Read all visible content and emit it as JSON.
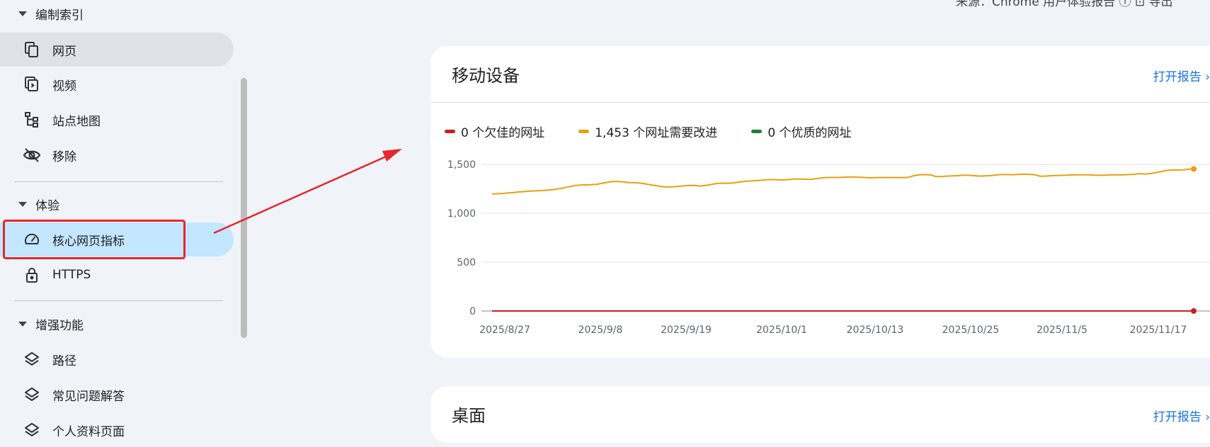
{
  "top_clip_text": "来源：Chrome 用户体验报告 ⓘ   ⊡ 导出",
  "sidebar": {
    "sections": [
      {
        "label": "编制索引"
      },
      {
        "label": "体验"
      },
      {
        "label": "增强功能"
      }
    ],
    "items": [
      {
        "label": "网页",
        "icon": "pages-icon"
      },
      {
        "label": "视频",
        "icon": "video-icon"
      },
      {
        "label": "站点地图",
        "icon": "sitemap-icon"
      },
      {
        "label": "移除",
        "icon": "eye-off-icon"
      },
      {
        "label": "核心网页指标",
        "icon": "speedometer-icon"
      },
      {
        "label": "HTTPS",
        "icon": "lock-icon"
      },
      {
        "label": "路径",
        "icon": "layers-icon"
      },
      {
        "label": "常见问题解答",
        "icon": "layers-icon"
      },
      {
        "label": "个人资料页面",
        "icon": "layers-icon"
      }
    ]
  },
  "mobile_card": {
    "title": "移动设备",
    "open_report": "打开报告 ›"
  },
  "desktop_card": {
    "title": "桌面",
    "open_report": "打开报告 ›"
  },
  "chart_data": {
    "type": "line",
    "title": "",
    "xlabel": "",
    "ylabel": "",
    "ylim": [
      0,
      1600
    ],
    "yticks": [
      "0",
      "500",
      "1,000",
      "1,500"
    ],
    "xticks": [
      "2025/8/27",
      "2025/9/8",
      "2025/9/19",
      "2025/10/1",
      "2025/10/13",
      "2025/10/25",
      "2025/11/5",
      "2025/11/17"
    ],
    "legend_position": "top-left",
    "series": [
      {
        "name": "0 个欠佳的网址",
        "color": "#c5221f",
        "values": [
          0,
          0,
          0,
          0,
          0,
          0,
          0,
          0,
          0,
          0,
          0,
          0,
          0,
          0,
          0,
          0,
          0,
          0,
          0,
          0,
          0,
          0,
          0,
          0,
          0,
          0,
          0,
          0,
          0,
          0,
          0,
          0,
          0,
          0,
          0,
          0,
          0,
          0,
          0,
          0,
          0,
          0,
          0,
          0,
          0,
          0,
          0,
          0,
          0,
          0,
          0,
          0,
          0,
          0,
          0,
          0,
          0,
          0,
          0,
          0,
          0,
          0,
          0,
          0,
          0,
          0,
          0,
          0,
          0,
          0,
          0,
          0,
          0,
          0,
          0,
          0,
          0,
          0,
          0,
          0,
          0,
          0,
          0,
          0,
          0,
          0,
          0,
          0,
          0
        ]
      },
      {
        "name": "1,453 个网址需要改进",
        "color": "#e8a10e",
        "values": [
          1198,
          1199,
          1202,
          1208,
          1212,
          1218,
          1222,
          1226,
          1229,
          1232,
          1236,
          1240,
          1248,
          1258,
          1270,
          1282,
          1288,
          1290,
          1292,
          1296,
          1305,
          1316,
          1324,
          1325,
          1320,
          1314,
          1312,
          1308,
          1300,
          1290,
          1282,
          1272,
          1268,
          1270,
          1275,
          1280,
          1284,
          1283,
          1278,
          1285,
          1294,
          1304,
          1308,
          1306,
          1310,
          1318,
          1326,
          1330,
          1333,
          1337,
          1342,
          1345,
          1342,
          1340,
          1344,
          1350,
          1350,
          1348,
          1346,
          1352,
          1360,
          1365,
          1366,
          1366,
          1368,
          1370,
          1370,
          1368,
          1365,
          1362,
          1364,
          1366,
          1365,
          1365,
          1366,
          1364,
          1368,
          1385,
          1394,
          1395,
          1392,
          1375,
          1376,
          1380,
          1382,
          1384,
          1390,
          1388,
          1384,
          1380,
          1382,
          1384,
          1392,
          1396,
          1396,
          1393,
          1398,
          1400,
          1398,
          1394,
          1378,
          1380,
          1384,
          1386,
          1388,
          1390,
          1392,
          1393,
          1393,
          1392,
          1390,
          1388,
          1390,
          1392,
          1393,
          1392,
          1395,
          1398,
          1405,
          1400,
          1405,
          1415,
          1425,
          1438,
          1442,
          1442,
          1444,
          1450,
          1453
        ]
      },
      {
        "name": "0 个优质的网址",
        "color": "#188038",
        "values": []
      }
    ]
  }
}
